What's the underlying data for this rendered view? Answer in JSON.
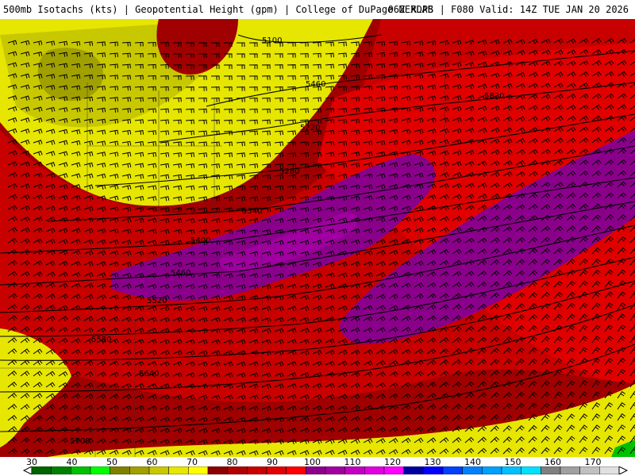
{
  "header": {
    "left": "500mb Isotachs (kts) | Geopotential Height (gpm) | College of DuPage NEXLAB",
    "right": "06Z RDPS | F080 Valid: 14Z TUE JAN 20 2026"
  },
  "contour_labels": [
    "5100",
    "5160",
    "5220",
    "5280",
    "5340",
    "5400",
    "5460",
    "5520",
    "5580",
    "5640",
    "5700",
    "5820"
  ],
  "colorbar": {
    "tick_labels": [
      "30",
      "40",
      "50",
      "60",
      "70",
      "80",
      "90",
      "100",
      "110",
      "120",
      "130",
      "140",
      "150",
      "160",
      "170"
    ],
    "colors": [
      "#006400",
      "#008000",
      "#00c000",
      "#00ff00",
      "#808000",
      "#a0a000",
      "#c8c800",
      "#e6e600",
      "#ffff00",
      "#8b0000",
      "#b00000",
      "#c80000",
      "#e00000",
      "#ff0000",
      "#8b008b",
      "#a000a0",
      "#c000c0",
      "#e000e0",
      "#ff00ff",
      "#0000a0",
      "#0000ff",
      "#0040ff",
      "#0080ff",
      "#00a0ff",
      "#00c0ff",
      "#00e0ff",
      "#808080",
      "#a0a0a0",
      "#c0c0c0",
      "#e0e0e0"
    ]
  },
  "palette": {
    "olive": "#a0a000",
    "olive_light": "#c8c800",
    "yellow": "#ffff00",
    "darkred": "#8b0000",
    "red": "#c80000",
    "brightred": "#ff0000",
    "purple": "#8b008b",
    "magenta": "#a000a0"
  }
}
